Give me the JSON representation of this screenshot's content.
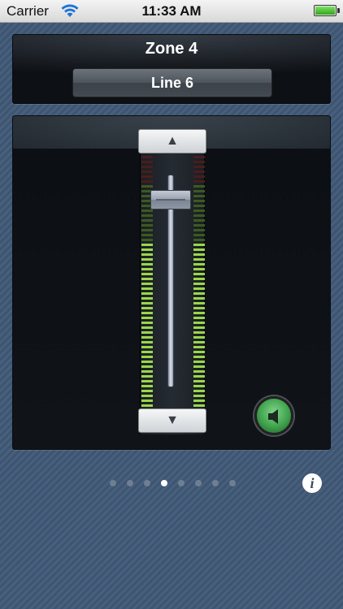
{
  "status_bar": {
    "carrier": "Carrier",
    "time": "11:33 AM",
    "battery_level": 1.0
  },
  "zone": {
    "title": "Zone 4",
    "source_button": "Line 6"
  },
  "fader": {
    "level": 0.92,
    "meter_left_level": 0.66,
    "meter_right_level": 0.66,
    "up_icon": "triangle-up-icon",
    "down_icon": "triangle-down-icon",
    "mute_icon": "speaker-icon",
    "up_glyph": "▲",
    "down_glyph": "▼"
  },
  "pager": {
    "total_pages": 8,
    "current_page": 4
  },
  "info_button": {
    "label": "i"
  },
  "colors": {
    "meter_green": "#9bd64a",
    "meter_green_dim": "#3c5a20",
    "meter_red_dim": "#4a1c1c",
    "mute_green": "#3fa24c"
  }
}
